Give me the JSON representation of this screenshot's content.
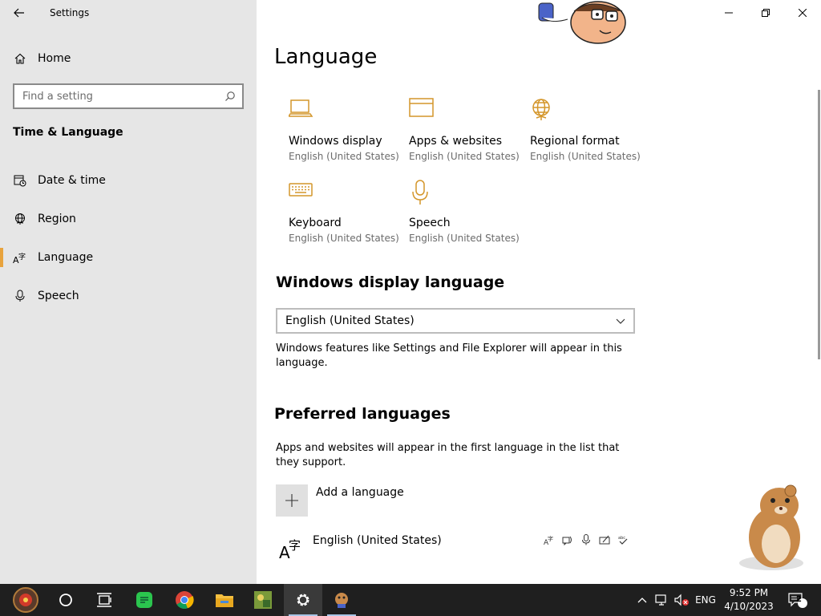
{
  "window": {
    "title": "Settings"
  },
  "sidebar": {
    "home_label": "Home",
    "search_placeholder": "Find a setting",
    "section_title": "Time & Language",
    "items": [
      {
        "label": "Date & time",
        "icon": "calendar-clock-icon"
      },
      {
        "label": "Region",
        "icon": "globe-icon"
      },
      {
        "label": "Language",
        "icon": "language-icon",
        "active": true
      },
      {
        "label": "Speech",
        "icon": "microphone-icon"
      }
    ]
  },
  "main": {
    "title": "Language",
    "tiles": [
      {
        "label": "Windows display",
        "sub": "English (United States)",
        "icon": "laptop-icon"
      },
      {
        "label": "Apps & websites",
        "sub": "English (United States)",
        "icon": "window-icon"
      },
      {
        "label": "Regional format",
        "sub": "English (United States)",
        "icon": "globe-icon"
      },
      {
        "label": "Keyboard",
        "sub": "English (United States)",
        "icon": "keyboard-icon"
      },
      {
        "label": "Speech",
        "sub": "English (United States)",
        "icon": "microphone-icon"
      }
    ],
    "display_language": {
      "heading": "Windows display language",
      "selected": "English (United States)",
      "description": "Windows features like Settings and File Explorer will appear in this language."
    },
    "preferred": {
      "heading": "Preferred languages",
      "description": "Apps and websites will appear in the first language in the list that they support.",
      "add_label": "Add a language",
      "languages": [
        {
          "name": "English (United States)"
        }
      ]
    }
  },
  "taskbar": {
    "language": "ENG",
    "time": "9:52 PM",
    "date": "4/10/2023",
    "notifications": "2"
  },
  "colors": {
    "accent": "#e8a33d",
    "sidebar_bg": "#e6e6e6",
    "taskbar_bg": "#1f1f1f"
  }
}
